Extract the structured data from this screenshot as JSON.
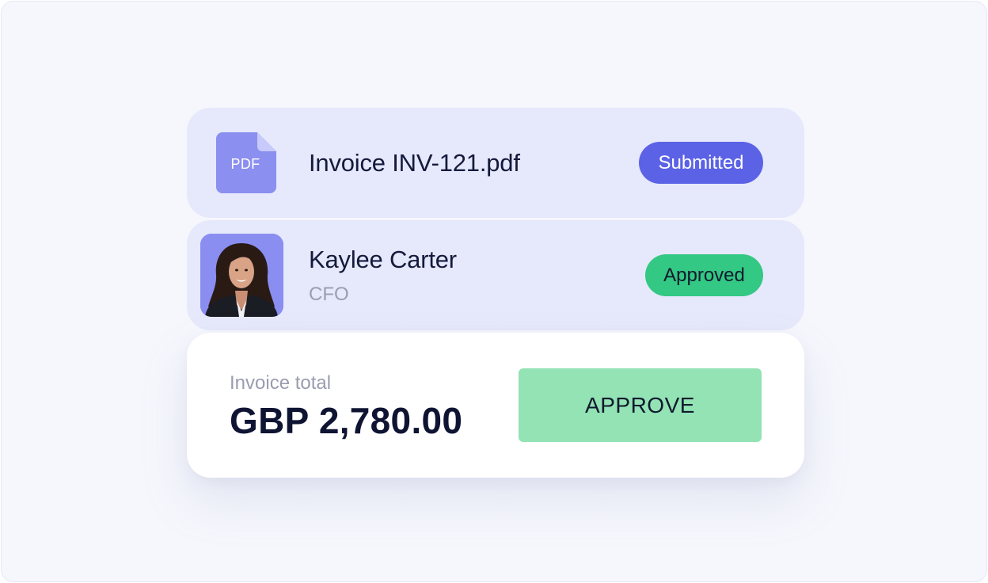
{
  "document": {
    "file_icon_text": "PDF",
    "filename": "Invoice INV-121.pdf",
    "status": "Submitted"
  },
  "approver": {
    "name": "Kaylee Carter",
    "role": "CFO",
    "status": "Approved"
  },
  "total": {
    "label": "Invoice total",
    "amount": "GBP 2,780.00",
    "action_label": "APPROVE"
  },
  "colors": {
    "accent": "#5b62e6",
    "card_tint": "#e6e8fb",
    "success": "#33c883",
    "approve_button": "#93e3b4",
    "pdf_icon": "#8b8ff0"
  },
  "icons": {
    "file": "pdf-file-icon",
    "avatar": "avatar-photo"
  }
}
